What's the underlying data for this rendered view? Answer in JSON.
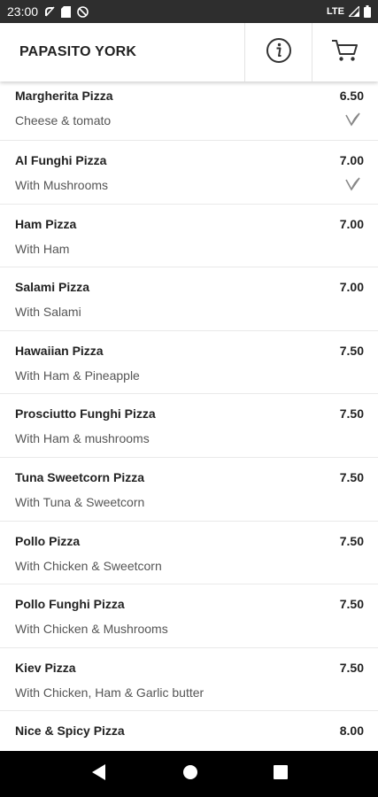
{
  "status_bar": {
    "time": "23:00",
    "network": "LTE",
    "left_icons": [
      "signal-off-icon",
      "sd-card-icon",
      "do-not-disturb-icon"
    ],
    "right_icons": [
      "cell-signal-icon",
      "battery-icon"
    ]
  },
  "app_bar": {
    "title": "PAPASITO YORK",
    "info_icon": "info-icon",
    "cart_icon": "cart-icon"
  },
  "menu": {
    "items": [
      {
        "name": "Margherita Pizza",
        "description": "Cheese & tomato",
        "price": "6.50",
        "vegetarian": true
      },
      {
        "name": "Al Funghi Pizza",
        "description": "With Mushrooms",
        "price": "7.00",
        "vegetarian": true
      },
      {
        "name": "Ham Pizza",
        "description": "With Ham",
        "price": "7.00",
        "vegetarian": false
      },
      {
        "name": "Salami Pizza",
        "description": "With Salami",
        "price": "7.00",
        "vegetarian": false
      },
      {
        "name": "Hawaiian Pizza",
        "description": "With Ham & Pineapple",
        "price": "7.50",
        "vegetarian": false
      },
      {
        "name": "Prosciutto Funghi Pizza",
        "description": "With Ham & mushrooms",
        "price": "7.50",
        "vegetarian": false
      },
      {
        "name": "Tuna Sweetcorn Pizza",
        "description": "With Tuna & Sweetcorn",
        "price": "7.50",
        "vegetarian": false
      },
      {
        "name": "Pollo Pizza",
        "description": "With Chicken & Sweetcorn",
        "price": "7.50",
        "vegetarian": false
      },
      {
        "name": "Pollo Funghi Pizza",
        "description": "With Chicken & Mushrooms",
        "price": "7.50",
        "vegetarian": false
      },
      {
        "name": "Kiev Pizza",
        "description": "With Chicken, Ham & Garlic butter",
        "price": "7.50",
        "vegetarian": false
      },
      {
        "name": "Nice & Spicy Pizza",
        "description": "",
        "price": "8.00",
        "vegetarian": false
      }
    ]
  },
  "nav_bar": {
    "back_icon": "back-triangle-icon",
    "home_icon": "home-circle-icon",
    "recents_icon": "recents-square-icon"
  },
  "colors": {
    "status_bar_bg": "#2e2e2e",
    "nav_bar_bg": "#000000",
    "divider": "#e9e9e9",
    "text_primary": "#222222",
    "text_secondary": "#555555",
    "veg_icon": "#888888"
  }
}
